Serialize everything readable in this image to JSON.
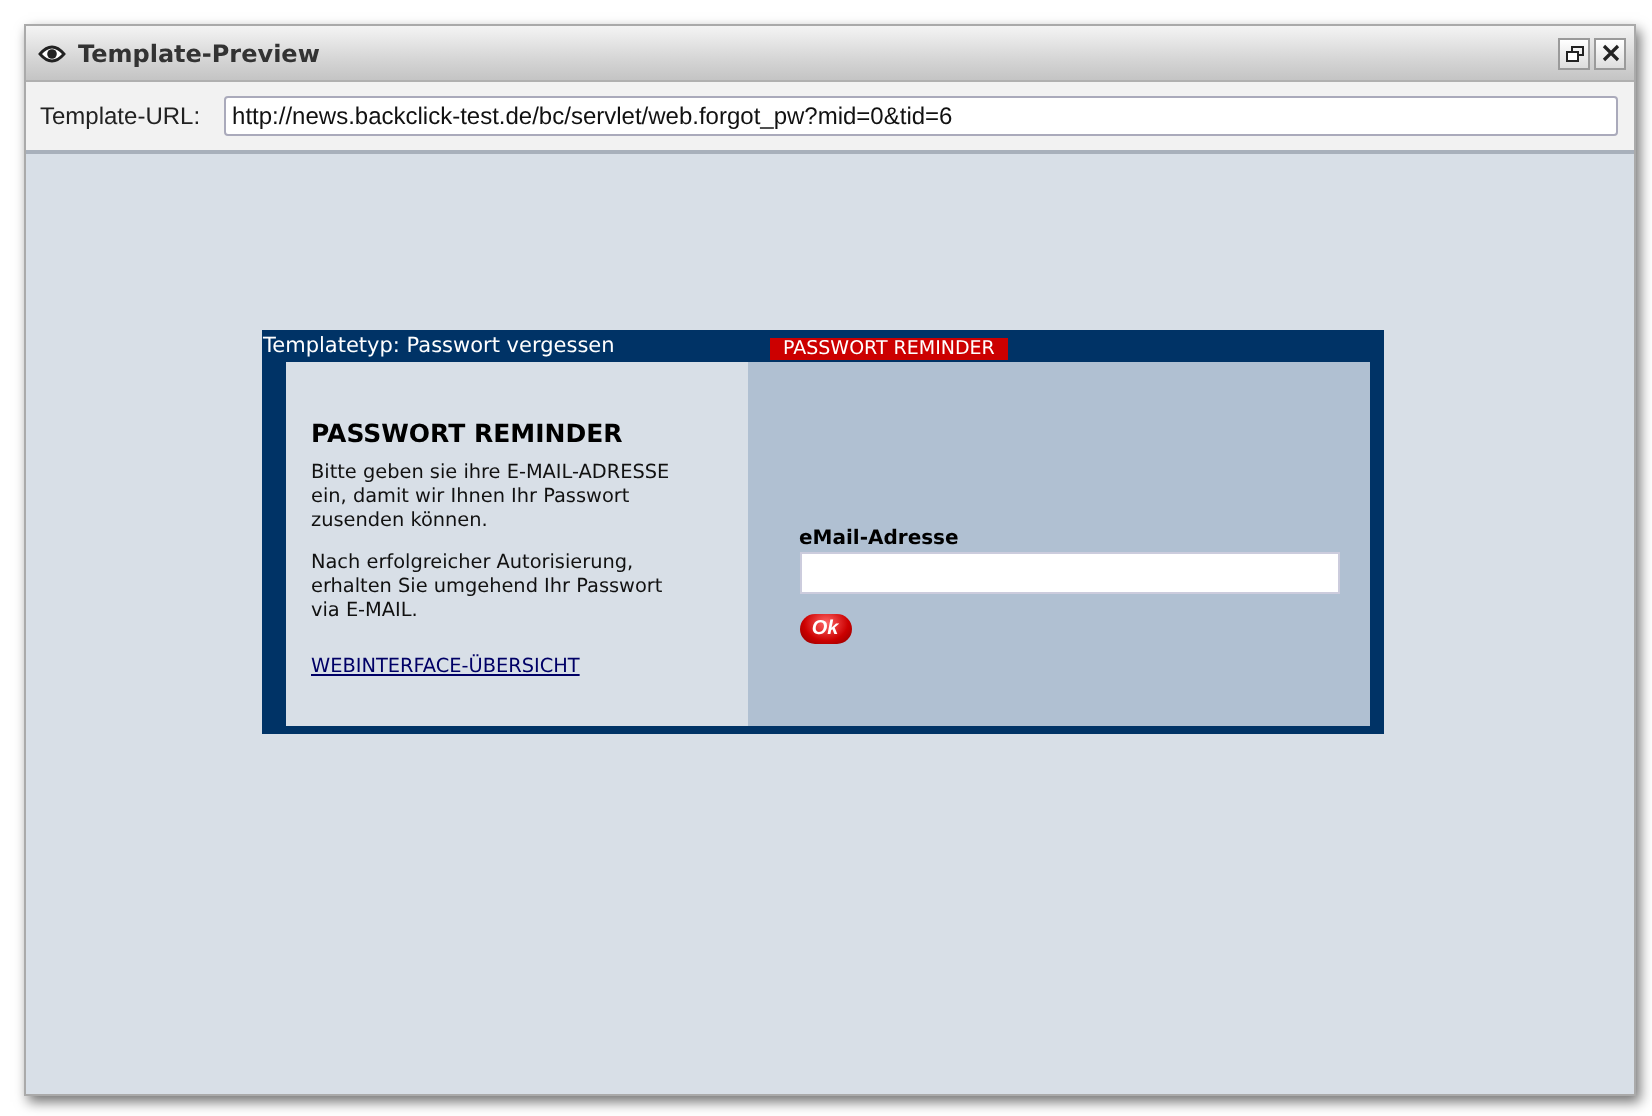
{
  "window": {
    "title": "Template-Preview"
  },
  "url_bar": {
    "label": "Template-URL:",
    "value": "http://news.backclick-test.de/bc/servlet/web.forgot_pw?mid=0&tid=6"
  },
  "preview": {
    "template_type": "Templatetyp: Passwort vergessen",
    "badge": "PASSWORT REMINDER",
    "heading": "PASSWORT REMINDER",
    "paragraphs": [
      "Bitte geben sie ihre E-MAIL-ADRESSE ein, damit wir Ihnen Ihr Passwort zusenden können.",
      "Nach erfolgreicher Autorisierung, erhalten Sie umgehend Ihr Passwort via E-MAIL."
    ],
    "link": "WEBINTERFACE-ÜBERSICHT",
    "email_label": "eMail-Adresse",
    "ok_button": "Ok"
  }
}
